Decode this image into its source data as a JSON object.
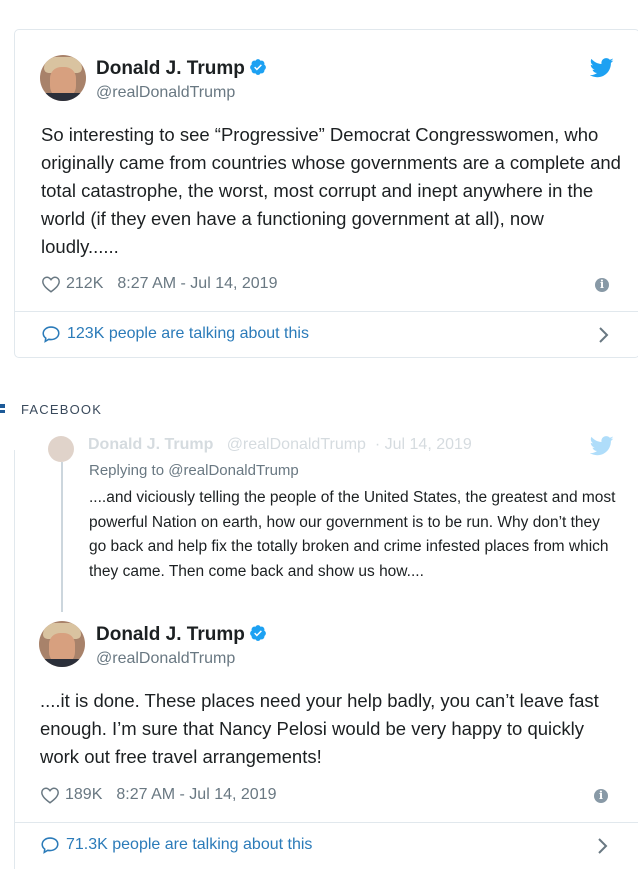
{
  "colors": {
    "link": "#2b7bb9",
    "muted": "#697882",
    "twitter_blue": "#1da1f2",
    "border": "#e1e8ed"
  },
  "tweet1": {
    "name": "Donald J. Trump",
    "handle": "@realDonaldTrump",
    "text": "So interesting to see “Progressive” Democrat Congresswomen, who originally came from countries whose governments are a complete and total catastrophe, the worst, most corrupt and inept anywhere in the world (if they even have a functioning government at all), now loudly......",
    "likes": "212K",
    "timestamp": "8:27 AM - Jul 14, 2019",
    "talking": "123K people are talking about this",
    "icons": [
      "verified-icon",
      "twitter-bird-icon",
      "heart-icon",
      "info-icon",
      "speech-bubble-icon",
      "chevron-right-icon"
    ]
  },
  "facebook_label": "FACEBOOK",
  "faded_header": {
    "name": "Donald J. Trump",
    "handle": "@realDonaldTrump",
    "date": "Jul 14, 2019"
  },
  "reply": {
    "replying_to": "Replying to @realDonaldTrump",
    "text": "....and viciously telling the people of the United States, the greatest and most powerful Nation on earth, how our government is to be run. Why don’t they go back and help fix the totally broken and crime infested places from which they came. Then come back and show us how...."
  },
  "tweet2": {
    "name": "Donald J. Trump",
    "handle": "@realDonaldTrump",
    "text": "....it is done. These places need your help badly, you can’t leave fast enough. I’m sure that Nancy Pelosi would be very happy to quickly work out free travel arrangements!",
    "likes": "189K",
    "timestamp": "8:27 AM - Jul 14, 2019",
    "talking": "71.3K people are talking about this"
  }
}
